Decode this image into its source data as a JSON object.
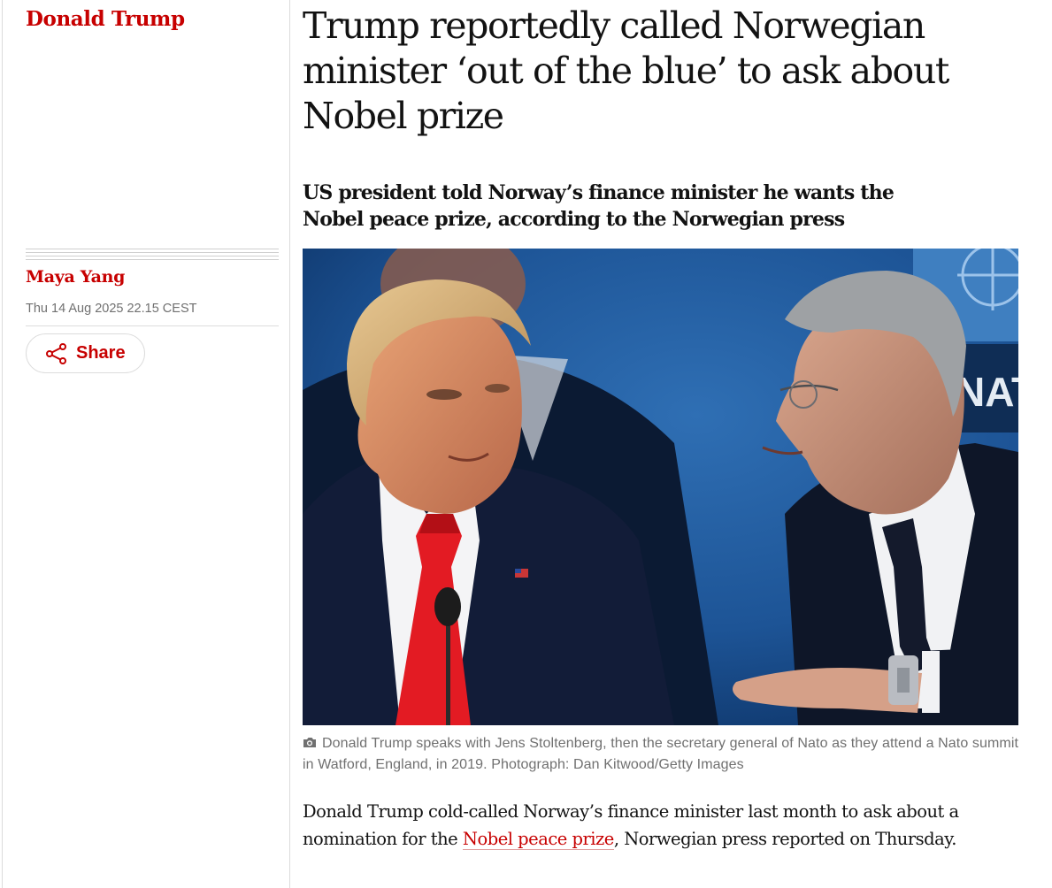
{
  "section": {
    "tag": "Donald Trump"
  },
  "meta": {
    "byline": "Maya Yang",
    "date": "Thu 14 Aug 2025 22.15 CEST",
    "share_label": "Share"
  },
  "article": {
    "headline": "Trump reportedly called Norwegian minister ‘out of the blue’ to ask about Nobel prize",
    "standfirst": "US president told Norway’s finance minister he wants the Nobel peace prize, according to the Norwegian press",
    "image": {
      "caption": "Donald Trump speaks with Jens Stoltenberg, then the secretary general of Nato as they attend a Nato summit in Watford, England, in 2019. Photograph: Dan Kitwood/Getty Images",
      "background_text": "NAT"
    },
    "body": {
      "before_link": "Donald Trump cold-called Norway’s finance minister last month to ask about a nomination for the ",
      "link_text": "Nobel peace prize",
      "after_link": ", Norwegian press reported on Thursday."
    }
  },
  "colors": {
    "brand_red": "#c70000",
    "text": "#121212",
    "meta_grey": "#707070",
    "rule_grey": "#dcdcdc"
  },
  "icons": [
    "share-icon",
    "camera-icon"
  ]
}
